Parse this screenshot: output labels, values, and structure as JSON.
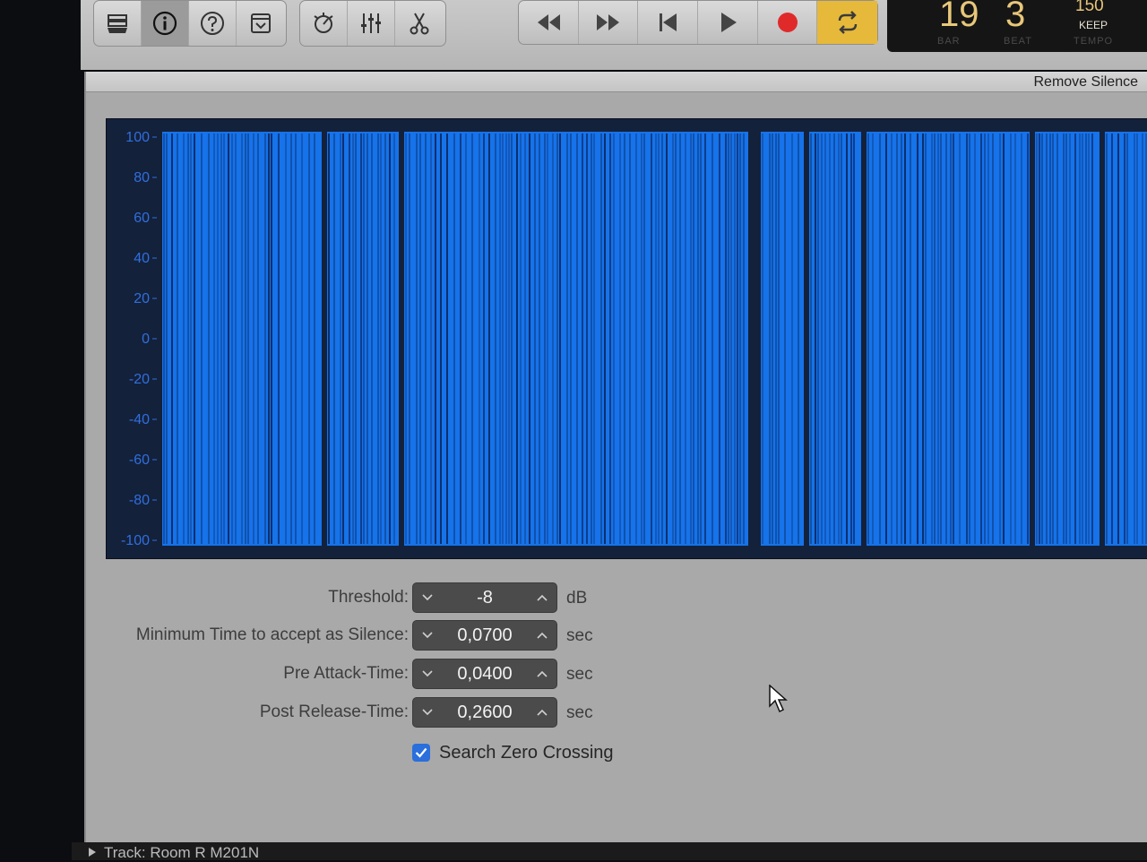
{
  "toolbar": {
    "left_buttons": [
      {
        "icon": "library-icon"
      },
      {
        "icon": "info-icon",
        "active": true
      },
      {
        "icon": "help-icon"
      },
      {
        "icon": "save-icon"
      }
    ],
    "edit_buttons": [
      {
        "icon": "metronome-icon"
      },
      {
        "icon": "mixer-icon"
      },
      {
        "icon": "scissors-icon"
      }
    ],
    "transport": [
      {
        "icon": "rewind-icon"
      },
      {
        "icon": "fast-forward-icon"
      },
      {
        "icon": "go-to-start-icon"
      },
      {
        "icon": "play-icon"
      },
      {
        "icon": "record-icon"
      },
      {
        "icon": "cycle-icon",
        "active": true
      }
    ]
  },
  "lcd": {
    "bar": "19",
    "beat": "3",
    "tempo": "150",
    "keep": "KEEP",
    "bar_label": "BAR",
    "beat_label": "BEAT",
    "tempo_label": "TEMPO"
  },
  "dialog": {
    "title": "Remove Silence",
    "axis_ticks": [
      "100",
      "80",
      "60",
      "40",
      "20",
      "0",
      "-20",
      "-40",
      "-60",
      "-80",
      "-100"
    ],
    "params": [
      {
        "label": "Threshold:",
        "value": "-8",
        "unit": "dB"
      },
      {
        "label": "Minimum Time to accept as Silence:",
        "value": "0,0700",
        "unit": "sec"
      },
      {
        "label": "Pre Attack-Time:",
        "value": "0,0400",
        "unit": "sec"
      },
      {
        "label": "Post Release-Time:",
        "value": "0,2600",
        "unit": "sec"
      }
    ],
    "search_zero_crossing": {
      "label": "Search Zero Crossing",
      "checked": true
    }
  },
  "track_strip": {
    "label": "Track:  Room R M201N"
  },
  "colors": {
    "waveform": "#1673ea",
    "waveform_bg": "#14213a",
    "accent": "#2a6fdc",
    "record": "#e02a2a",
    "cycle": "#e6b93a"
  }
}
